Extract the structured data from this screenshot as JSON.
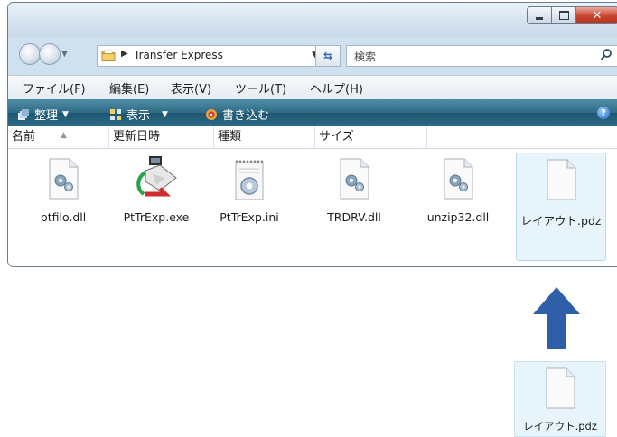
{
  "window": {
    "address_path": "Transfer Express",
    "search_placeholder": "検索",
    "menu": [
      {
        "label": "ファイル(F)"
      },
      {
        "label": "編集(E)"
      },
      {
        "label": "表示(V)"
      },
      {
        "label": "ツール(T)"
      },
      {
        "label": "ヘルプ(H)"
      }
    ],
    "toolbar": {
      "organize": "整理",
      "views": "表示",
      "burn": "書き込む"
    },
    "columns": [
      "名前",
      "更新日時",
      "種類",
      "サイズ"
    ],
    "files": [
      {
        "name": "ptfilo.dll",
        "icon": "dll-gear-icon"
      },
      {
        "name": "PtTrExp.exe",
        "icon": "exe-app-icon"
      },
      {
        "name": "PtTrExp.ini",
        "icon": "ini-settings-icon"
      },
      {
        "name": "TRDRV.dll",
        "icon": "dll-gear-icon"
      },
      {
        "name": "unzip32.dll",
        "icon": "dll-gear-icon"
      },
      {
        "name": "レイアウト.pdz",
        "icon": "blank-document-icon",
        "selected": true
      }
    ]
  },
  "dragged_file": {
    "name": "レイアウト.pdz",
    "icon": "blank-document-icon"
  },
  "colors": {
    "arrow": "#2f5fa8",
    "toolbar": "#2b6a86",
    "selection": "#e8f4fc"
  }
}
